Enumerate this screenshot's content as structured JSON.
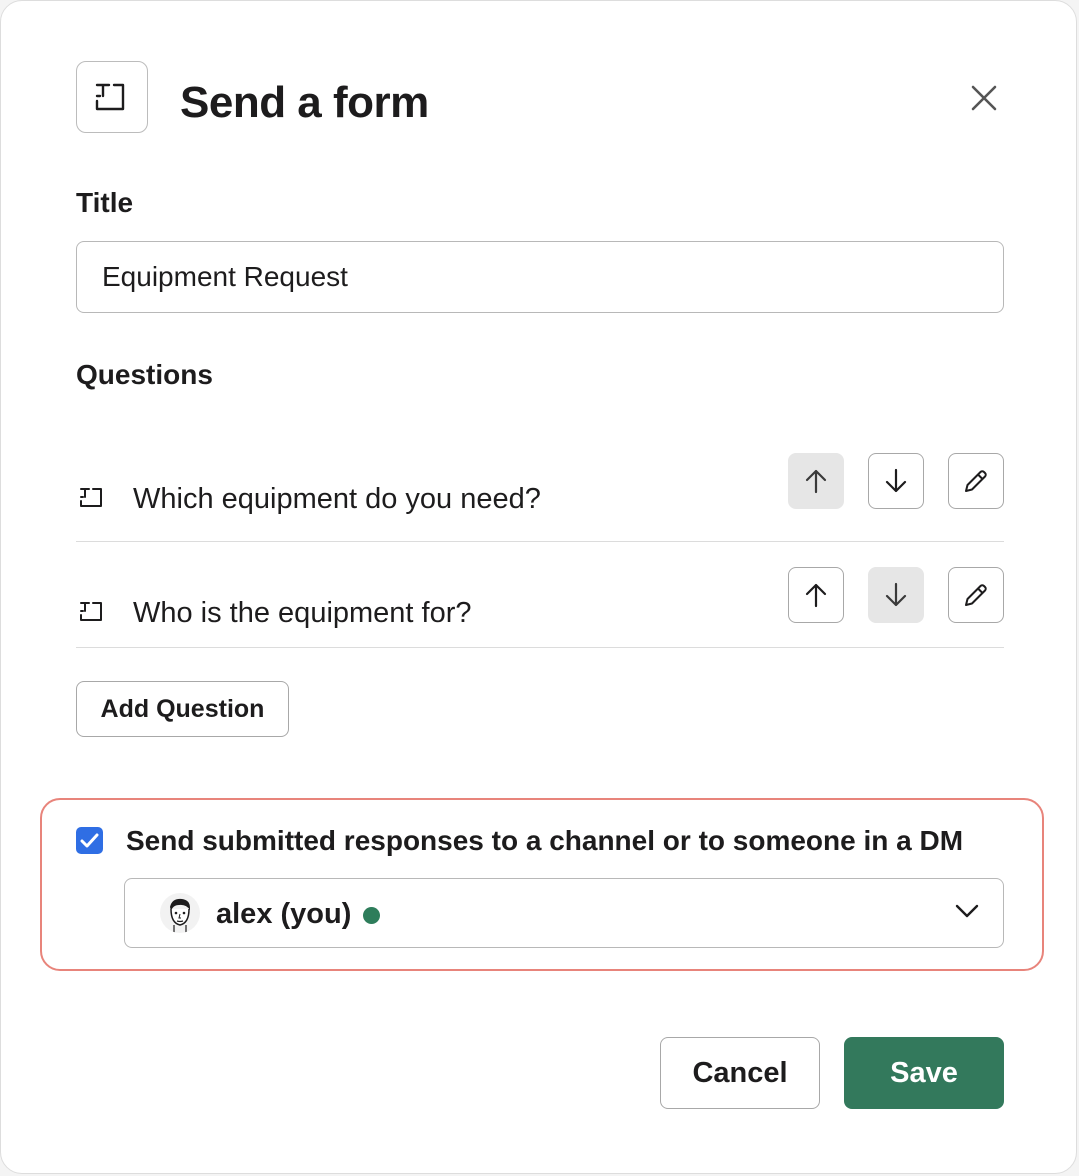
{
  "modal": {
    "title": "Send a form",
    "header_icon": "text-field-icon",
    "close_icon": "close-icon"
  },
  "title_field": {
    "label": "Title",
    "value": "Equipment Request"
  },
  "questions": {
    "label": "Questions",
    "items": [
      {
        "text": "Which equipment do you need?",
        "icon": "text-field-icon",
        "move_up_enabled": false,
        "move_down_enabled": true
      },
      {
        "text": "Who is the equipment for?",
        "icon": "text-field-icon",
        "move_up_enabled": true,
        "move_down_enabled": false
      }
    ]
  },
  "add_question_label": "Add Question",
  "responses": {
    "checkbox_checked": true,
    "checkbox_label": "Send submitted responses to a channel or to someone in a DM",
    "selected_user": "alex (you)",
    "presence": "active"
  },
  "footer": {
    "cancel_label": "Cancel",
    "save_label": "Save"
  },
  "colors": {
    "save_button": "#33795c",
    "presence_dot": "#2e7d5b",
    "checkbox": "#2f6ee4",
    "highlight_border": "#e8847b"
  }
}
